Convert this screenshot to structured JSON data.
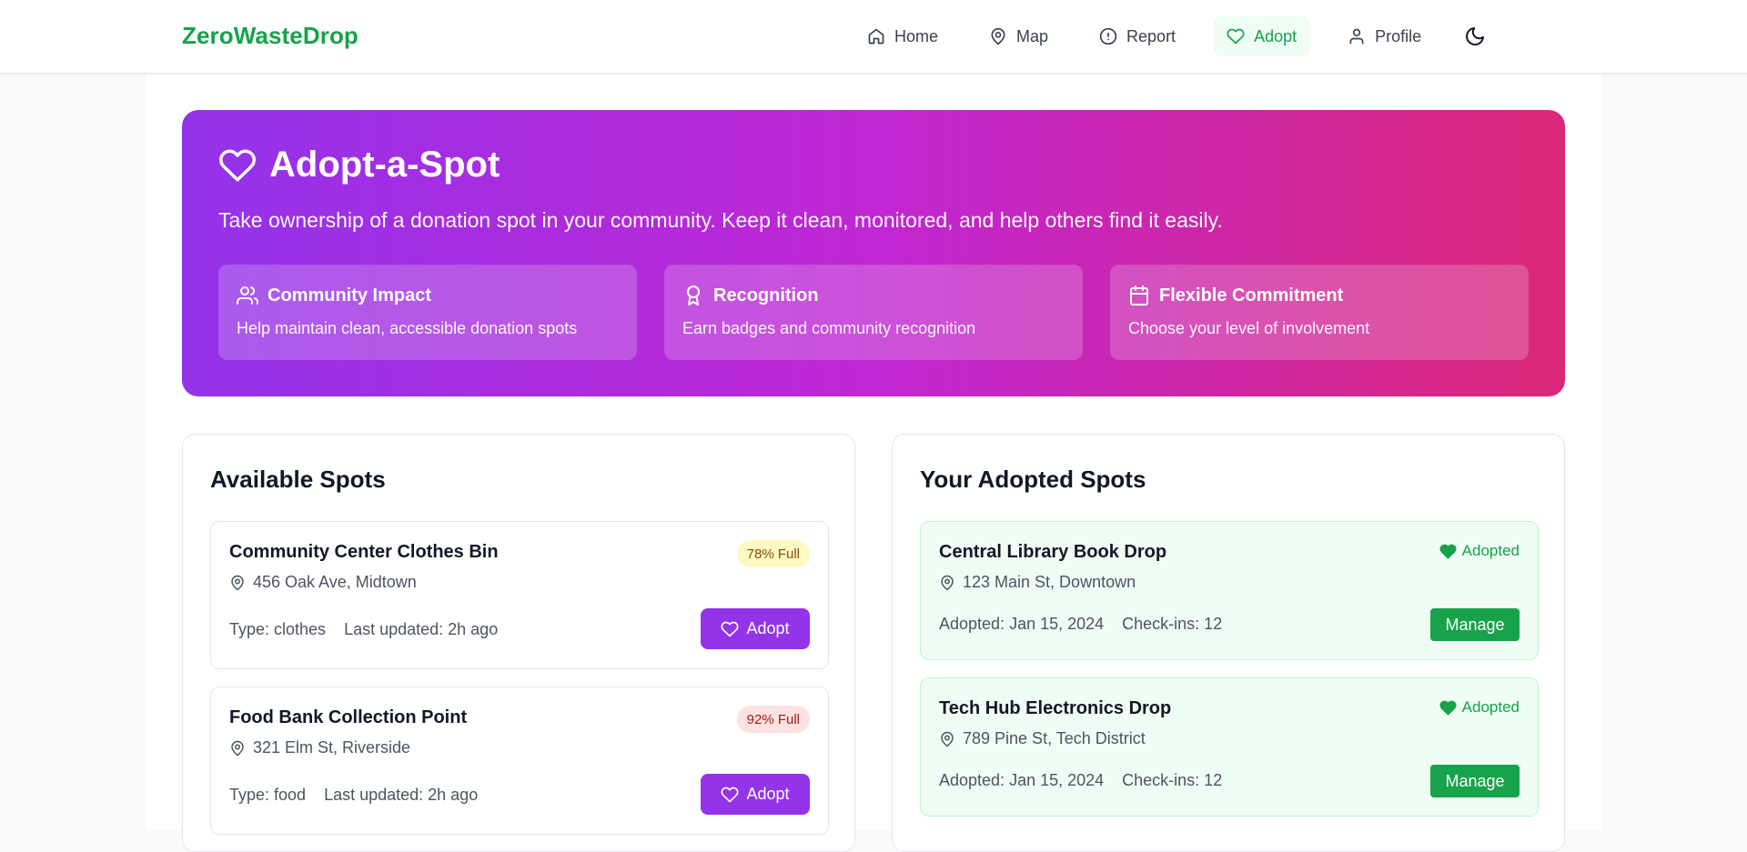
{
  "header": {
    "brand": "ZeroWasteDrop",
    "nav": [
      {
        "label": "Home",
        "icon": "home-icon"
      },
      {
        "label": "Map",
        "icon": "map-pin-icon"
      },
      {
        "label": "Report",
        "icon": "alert-circle-icon"
      },
      {
        "label": "Adopt",
        "icon": "heart-icon",
        "active": true
      },
      {
        "label": "Profile",
        "icon": "user-icon"
      }
    ],
    "theme_toggle_icon": "moon-icon"
  },
  "hero": {
    "title": "Adopt-a-Spot",
    "subtitle": "Take ownership of a donation spot in your community. Keep it clean, monitored, and help others find it easily.",
    "features": [
      {
        "title": "Community Impact",
        "description": "Help maintain clean, accessible donation spots",
        "icon": "users-icon"
      },
      {
        "title": "Recognition",
        "description": "Earn badges and community recognition",
        "icon": "award-icon"
      },
      {
        "title": "Flexible Commitment",
        "description": "Choose your level of involvement",
        "icon": "calendar-icon"
      }
    ]
  },
  "available": {
    "title": "Available Spots",
    "spots": [
      {
        "name": "Community Center Clothes Bin",
        "address": "456 Oak Ave, Midtown",
        "type": "Type: clothes",
        "updated": "Last updated: 2h ago",
        "fill": "78% Full",
        "fill_level": "yellow",
        "button": "Adopt"
      },
      {
        "name": "Food Bank Collection Point",
        "address": "321 Elm St, Riverside",
        "type": "Type: food",
        "updated": "Last updated: 2h ago",
        "fill": "92% Full",
        "fill_level": "red",
        "button": "Adopt"
      }
    ]
  },
  "adopted": {
    "title": "Your Adopted Spots",
    "spots": [
      {
        "name": "Central Library Book Drop",
        "address": "123 Main St, Downtown",
        "status": "Adopted",
        "adopted_on": "Adopted: Jan 15, 2024",
        "checkins": "Check-ins: 12",
        "button": "Manage"
      },
      {
        "name": "Tech Hub Electronics Drop",
        "address": "789 Pine St, Tech District",
        "status": "Adopted",
        "adopted_on": "Adopted: Jan 15, 2024",
        "checkins": "Check-ins: 12",
        "button": "Manage"
      }
    ]
  },
  "colors": {
    "brand_green": "#16a34a",
    "accent_purple": "#9333ea",
    "hero_gradient_start": "#9333ea",
    "hero_gradient_end": "#db2777"
  }
}
